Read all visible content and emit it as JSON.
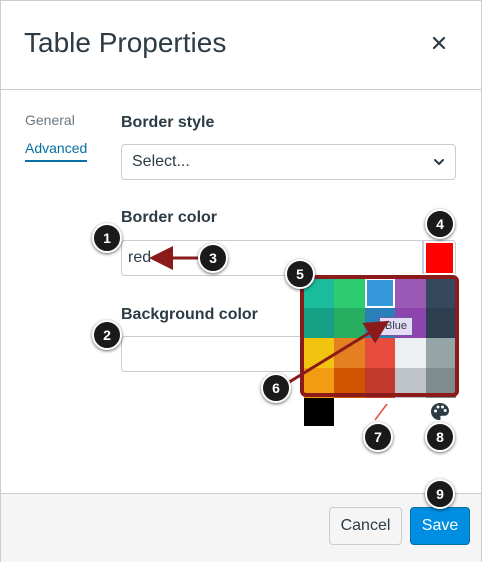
{
  "dialog": {
    "title": "Table Properties",
    "close_icon": "close-icon"
  },
  "tabs": [
    {
      "label": "General",
      "active": false
    },
    {
      "label": "Advanced",
      "active": true
    }
  ],
  "border_style": {
    "label": "Border style",
    "value": "Select..."
  },
  "border_color": {
    "label": "Border color",
    "value": "red",
    "swatch_color": "#ff0000"
  },
  "background_color": {
    "label": "Background color",
    "value": ""
  },
  "palette": {
    "colors": [
      "#1abc9c",
      "#2ecc71",
      "#3498db",
      "#9b59b6",
      "#34495e",
      "#16a085",
      "#27ae60",
      "#2980b9",
      "#8e44ad",
      "#2c3e50",
      "#f1c40f",
      "#e67e22",
      "#e74c3c",
      "#ecf0f1",
      "#95a5a6",
      "#f39c12",
      "#d35400",
      "#c0392b",
      "#bdc3c7",
      "#7f8c8d"
    ],
    "selected_index": 2,
    "extra_black": "#000000",
    "tooltip": "Blue",
    "no_color_icon": "no-color-slash-icon",
    "custom_color_icon": "palette-icon"
  },
  "footer": {
    "cancel_label": "Cancel",
    "save_label": "Save",
    "save_color": "#008ee2"
  },
  "callouts": [
    "1",
    "2",
    "3",
    "4",
    "5",
    "6",
    "7",
    "8",
    "9"
  ],
  "annotation_color": "#8b1a1a"
}
